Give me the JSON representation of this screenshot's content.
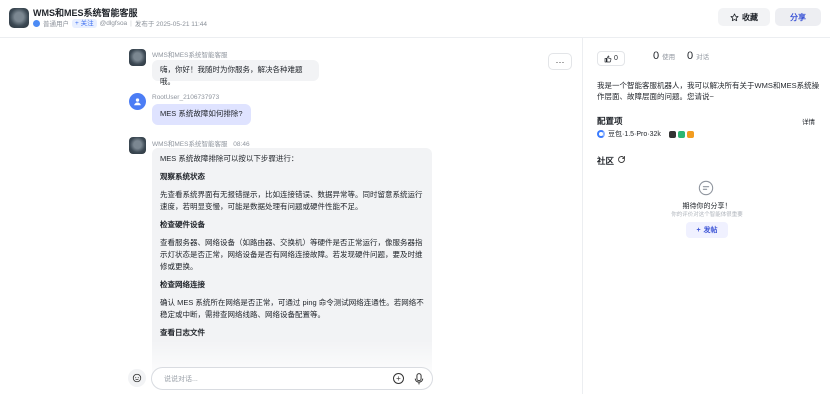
{
  "header": {
    "title": "WMS和MES系统智能客服",
    "user_type": "普通用户",
    "follow_label": "+ 关注",
    "handle": "@dlgfsoa",
    "published": "发布于 2025-05-21 11:44",
    "collect_label": "收藏",
    "share_label": "分享"
  },
  "chat": {
    "messages": [
      {
        "sender": "WMS和MES系统智能客服",
        "text": "嗨，你好！我随时为你服务，解决各种难题哦。"
      },
      {
        "sender": "RootUser_2106737973",
        "text": "MES 系统故障如何排除?"
      },
      {
        "sender": "WMS和MES系统智能客服",
        "time": "08:46",
        "intro": "MES 系统故障排除可以按以下步骤进行：",
        "sections": [
          {
            "heading": "观察系统状态",
            "body": "先查看系统界面有无报错提示，比如连接错误、数据异常等。同时留意系统运行速度，若明显变慢，可能是数据处理有问题或硬件性能不足。"
          },
          {
            "heading": "检查硬件设备",
            "body": "查看服务器、网络设备（如路由器、交换机）等硬件是否正常运行，像服务器指示灯状态是否正常，网络设备是否有网络连接故障。若发现硬件问题，要及时维修或更换。"
          },
          {
            "heading": "检查网络连接",
            "body": "确认 MES 系统所在网络是否正常，可通过 ping 命令测试网络连通性。若网络不稳定或中断，需排查网络线路、网络设备配置等。"
          },
          {
            "heading": "查看日志文件",
            "body": ""
          }
        ]
      }
    ],
    "input_placeholder": "说说对话..."
  },
  "panel": {
    "likes": "0",
    "uses": "0",
    "uses_label": "使用",
    "conversations": "0",
    "conversations_label": "对话",
    "description": "我是一个智能客服机器人，我可以解决所有关于WMS和MES系统操作层面、故障层面的问题。您请说~",
    "config_title": "配置项",
    "details_label": "详情",
    "model_name": "豆包·1.5·Pro·32k",
    "community_title": "社区",
    "empty_title": "期待你的分享！",
    "empty_sub": "你的评价对这个智能体很重要",
    "post_label": "发帖"
  },
  "colors": {
    "accent": "#3c54d6",
    "user_bubble": "#dfe3ff",
    "bot_bubble": "#f2f3f5"
  }
}
